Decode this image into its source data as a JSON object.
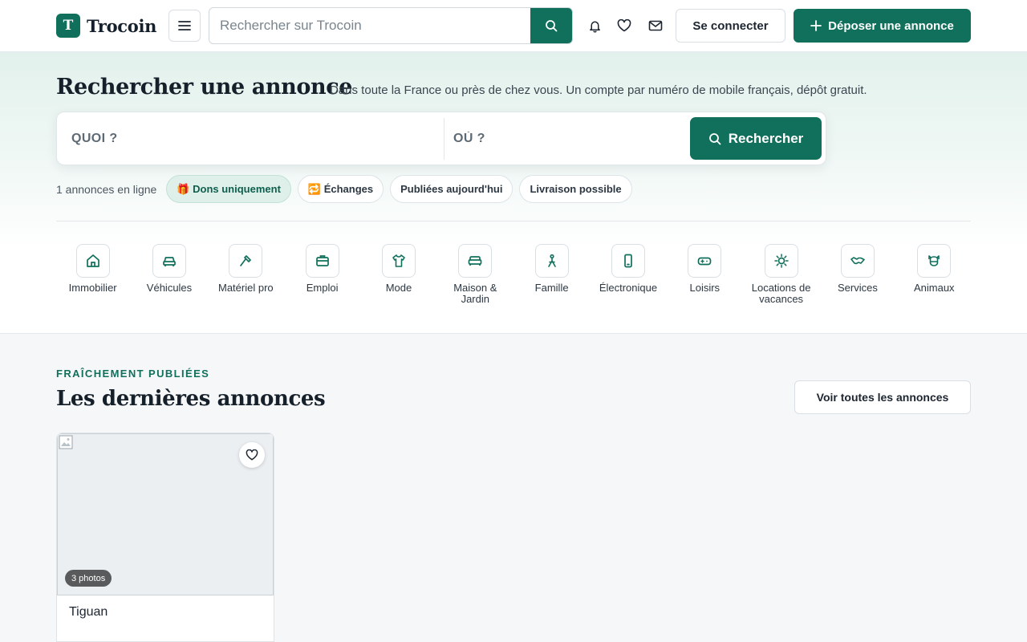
{
  "header": {
    "logo_letter": "T",
    "logo_text": "Trocoin",
    "search_placeholder": "Rechercher sur Trocoin",
    "login_label": "Se connecter",
    "post_label": "Déposer une annonce"
  },
  "hero": {
    "title": "Rechercher une annonce",
    "subtitle": "Dans toute la France ou près de chez vous. Un compte par numéro de mobile français, dépôt gratuit.",
    "what_placeholder": "QUOI ?",
    "where_placeholder": "OÙ ?",
    "search_label": "Rechercher",
    "count_text": "1 annonces en ligne",
    "chips": [
      {
        "label": "🎁 Dons uniquement",
        "active": true
      },
      {
        "label": "🔁 Échanges",
        "active": false
      },
      {
        "label": "Publiées aujourd'hui",
        "active": false
      },
      {
        "label": "Livraison possible",
        "active": false
      }
    ]
  },
  "categories": [
    {
      "label": "Immobilier",
      "icon": "house-icon"
    },
    {
      "label": "Véhicules",
      "icon": "car-icon"
    },
    {
      "label": "Matériel pro",
      "icon": "hammer-icon"
    },
    {
      "label": "Emploi",
      "icon": "briefcase-icon"
    },
    {
      "label": "Mode",
      "icon": "shirt-icon"
    },
    {
      "label": "Maison & Jardin",
      "icon": "sofa-icon"
    },
    {
      "label": "Famille",
      "icon": "family-icon"
    },
    {
      "label": "Électronique",
      "icon": "phone-icon"
    },
    {
      "label": "Loisirs",
      "icon": "gamepad-icon"
    },
    {
      "label": "Locations de vacances",
      "icon": "sun-icon"
    },
    {
      "label": "Services",
      "icon": "handshake-icon"
    },
    {
      "label": "Animaux",
      "icon": "dog-icon"
    }
  ],
  "latest": {
    "eyebrow": "FRAÎCHEMENT PUBLIÉES",
    "title": "Les dernières annonces",
    "see_all_label": "Voir toutes les annonces",
    "listings": [
      {
        "title": "Tiguan",
        "photo_count": "3 photos"
      }
    ]
  },
  "colors": {
    "brand": "#10705c",
    "brand_light": "#def0e9",
    "text": "#1c2530",
    "page_bg": "#f5f7f9"
  }
}
